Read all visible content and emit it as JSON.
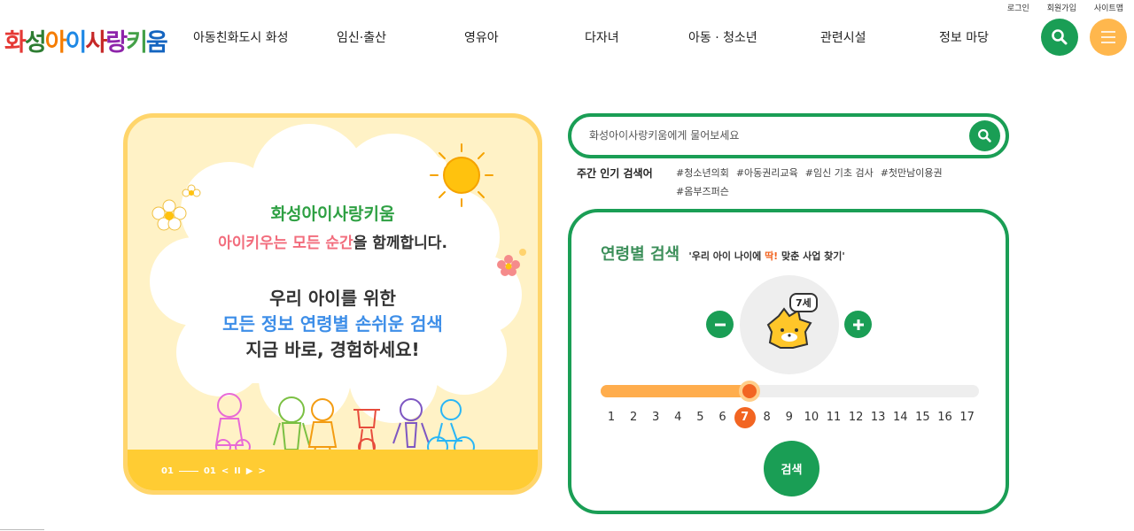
{
  "util": {
    "login": "로그인",
    "join": "회원가입",
    "sitemap": "사이트맵"
  },
  "logo": {
    "text": "화성아이사랑키움",
    "chars": [
      {
        "c": "화",
        "color": "#e53935"
      },
      {
        "c": "성",
        "color": "#2e7d32"
      },
      {
        "c": "아",
        "color": "#f57c00"
      },
      {
        "c": "이",
        "color": "#1e88e5"
      },
      {
        "c": "사",
        "color": "#c62828"
      },
      {
        "c": "랑",
        "color": "#8e24aa"
      },
      {
        "c": "키",
        "color": "#43a047"
      },
      {
        "c": "움",
        "color": "#1565c0"
      }
    ]
  },
  "nav": [
    "아동친화도시 화성",
    "임신·출산",
    "영유아",
    "다자녀",
    "아동 · 청소년",
    "관련시설",
    "정보 마당"
  ],
  "icons": {
    "search": "search-icon",
    "menu": "hamburger-menu-icon"
  },
  "colors": {
    "primary": "#1a9e55",
    "accent": "#f26522",
    "menu": "#ffb74d",
    "banner": "#fff2c6"
  },
  "banner": {
    "line1": "화성아이사랑키움",
    "line2_red": "아이키우는 모든 순간",
    "line2_rest": "을 함께합니다.",
    "line3": "우리 아이를 위한",
    "line4": "모든 정보 연령별 손쉬운 검색",
    "line5": "지금 바로, 경험하세요!",
    "pager_current": "01",
    "pager_total": "01",
    "prev": "<",
    "pause": "II",
    "play": "▶",
    "next": ">"
  },
  "search": {
    "placeholder": "화성아이사랑키움에게 물어보세요"
  },
  "popular": {
    "label": "주간 인기 검색어",
    "tags": [
      "#청소년의회",
      "#아동권리교육",
      "#임신 기초 검사",
      "#첫만남이용권",
      "#옴부즈퍼슨"
    ]
  },
  "age_search": {
    "title": "연령별 검색",
    "sub_pre": "'우리 아이 나이에 ",
    "sub_hl": "딱!",
    "sub_post": " 맞춘 사업 찾기'",
    "age_label": "7세",
    "selected_age": 7,
    "min": 1,
    "max": 17,
    "ages": [
      "1",
      "2",
      "3",
      "4",
      "5",
      "6",
      "7",
      "8",
      "9",
      "10",
      "11",
      "12",
      "13",
      "14",
      "15",
      "16",
      "17"
    ],
    "submit": "검색"
  }
}
